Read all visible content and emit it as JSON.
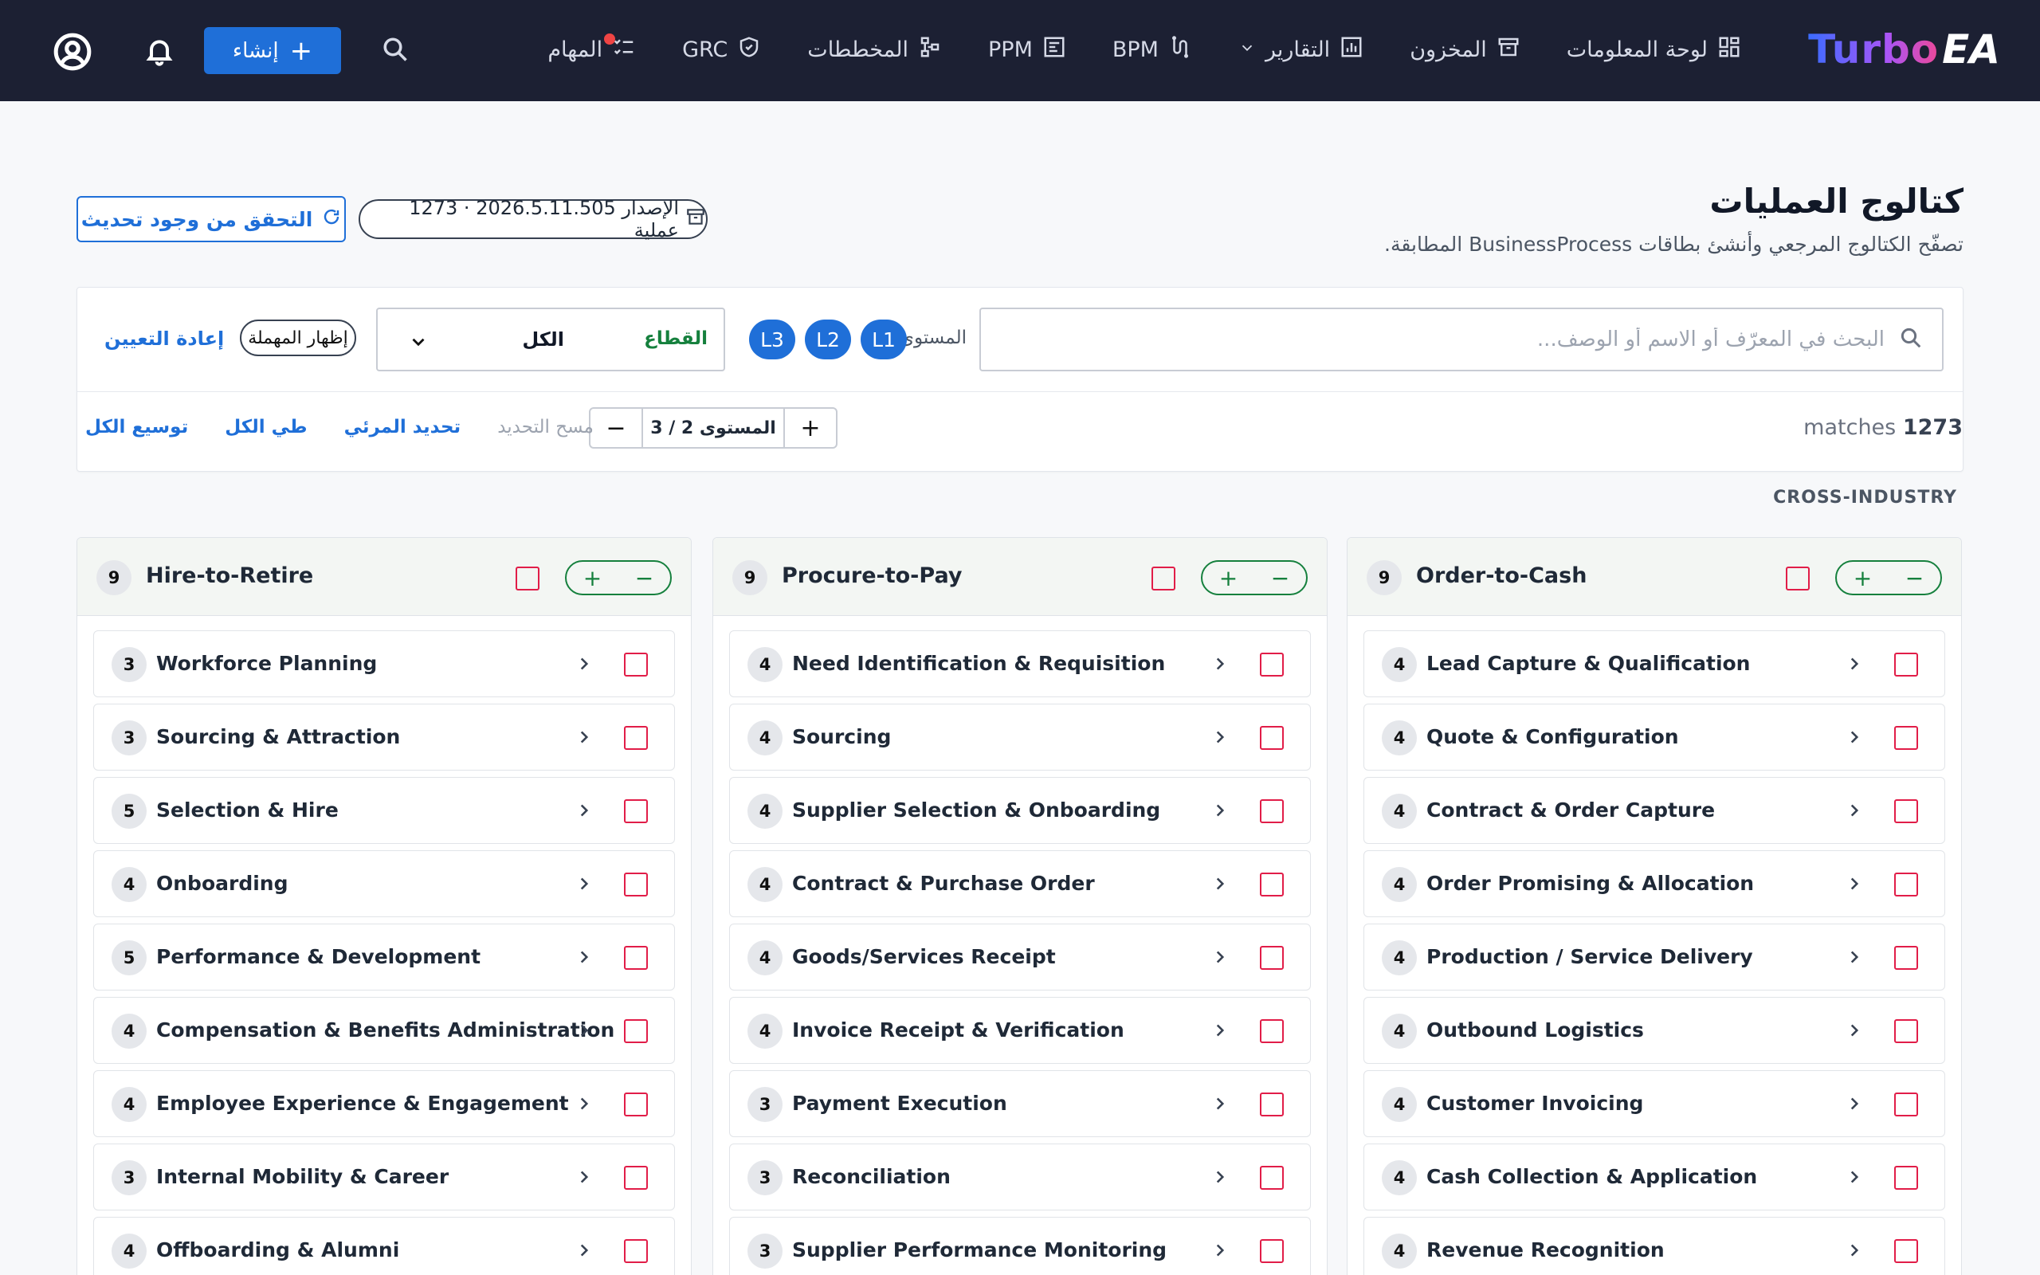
{
  "app": {
    "logo_main": "Turbo",
    "logo_suffix": "EA"
  },
  "nav": {
    "items": [
      {
        "key": "dashboard",
        "label": "لوحة المعلومات",
        "icon": "dashboard-grid-icon"
      },
      {
        "key": "inventory",
        "label": "المخزون",
        "icon": "archive-box-icon"
      },
      {
        "key": "reports",
        "label": "التقارير",
        "icon": "bar-chart-icon"
      },
      {
        "key": "bpm",
        "label": "BPM",
        "icon": "route-icon"
      },
      {
        "key": "ppm",
        "label": "PPM",
        "icon": "kanban-board-icon"
      },
      {
        "key": "diagrams",
        "label": "المخططات",
        "icon": "diagram-nodes-icon"
      },
      {
        "key": "grc",
        "label": "GRC",
        "icon": "shield-check-icon"
      },
      {
        "key": "tasks",
        "label": "المهام",
        "icon": "checklist-icon"
      }
    ],
    "create_label": "إنشاء"
  },
  "header": {
    "title": "كتالوج العمليات",
    "subtitle": "تصفّح الكتالوج المرجعي وأنشئ بطاقات BusinessProcess المطابقة.",
    "version_text": "الإصدار 2026.5.11.505 · 1273 عملية",
    "check_update_label": "التحقق من وجود تحديث"
  },
  "filters": {
    "search_placeholder": "البحث في المعرّف أو الاسم أو الوصف...",
    "level_label": "المستوى",
    "levels": [
      "L1",
      "L2",
      "L3"
    ],
    "sector_label": "القطاع",
    "sector_value": "الكل",
    "deadline_toggle": "إظهار المهملة",
    "reset_label": "إعادة التعيين"
  },
  "toolbar": {
    "matches_count": "1273",
    "matches_word": "matches",
    "level_stepper": "المستوى 2 / 3",
    "expand_all": "توسيع الكل",
    "collapse_all": "طي الكل",
    "select_visible": "تحديد المرئي",
    "clear_selection": "مسح التحديد"
  },
  "section": {
    "label": "CROSS-INDUSTRY"
  },
  "columns": [
    {
      "title": "Order-to-Cash",
      "count": "9",
      "items": [
        {
          "count": "4",
          "label": "Lead Capture & Qualification"
        },
        {
          "count": "4",
          "label": "Quote & Configuration"
        },
        {
          "count": "4",
          "label": "Contract & Order Capture"
        },
        {
          "count": "4",
          "label": "Order Promising & Allocation"
        },
        {
          "count": "4",
          "label": "Production / Service Delivery"
        },
        {
          "count": "4",
          "label": "Outbound Logistics"
        },
        {
          "count": "4",
          "label": "Customer Invoicing"
        },
        {
          "count": "4",
          "label": "Cash Collection & Application"
        },
        {
          "count": "4",
          "label": "Revenue Recognition"
        }
      ]
    },
    {
      "title": "Procure-to-Pay",
      "count": "9",
      "items": [
        {
          "count": "4",
          "label": "Need Identification & Requisition"
        },
        {
          "count": "4",
          "label": "Sourcing"
        },
        {
          "count": "4",
          "label": "Supplier Selection & Onboarding"
        },
        {
          "count": "4",
          "label": "Contract & Purchase Order"
        },
        {
          "count": "4",
          "label": "Goods/Services Receipt"
        },
        {
          "count": "4",
          "label": "Invoice Receipt & Verification"
        },
        {
          "count": "3",
          "label": "Payment Execution"
        },
        {
          "count": "3",
          "label": "Reconciliation"
        },
        {
          "count": "3",
          "label": "Supplier Performance Monitoring"
        }
      ]
    },
    {
      "title": "Hire-to-Retire",
      "count": "9",
      "items": [
        {
          "count": "3",
          "label": "Workforce Planning"
        },
        {
          "count": "3",
          "label": "Sourcing & Attraction"
        },
        {
          "count": "5",
          "label": "Selection & Hire"
        },
        {
          "count": "4",
          "label": "Onboarding"
        },
        {
          "count": "5",
          "label": "Performance & Development"
        },
        {
          "count": "4",
          "label": "Compensation & Benefits Administration"
        },
        {
          "count": "4",
          "label": "Employee Experience & Engagement"
        },
        {
          "count": "3",
          "label": "Internal Mobility & Career"
        },
        {
          "count": "4",
          "label": "Offboarding & Alumni"
        }
      ]
    }
  ]
}
